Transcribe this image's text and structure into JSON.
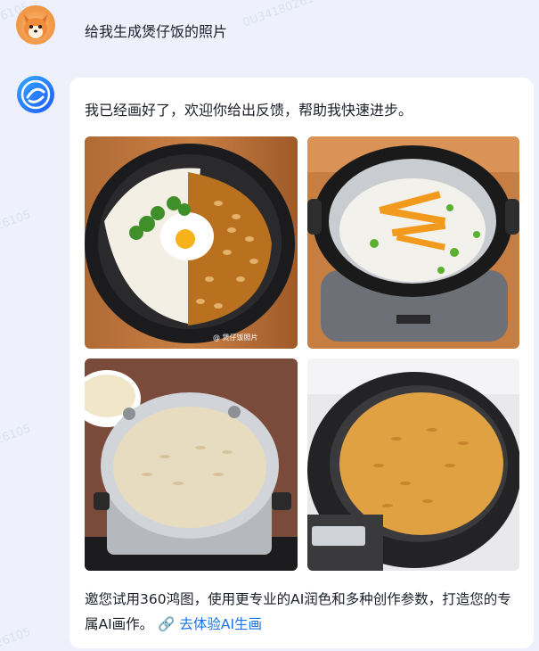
{
  "conversation": {
    "user_prompt": "给我生成煲仔饭的照片",
    "assistant_reply": "我已经画好了，欢迎你给出反馈，帮助我快速进步。",
    "footer_text": "邀您试用360鸿图，使用更专业的AI润色和多种创作参数，打造您的专属AI画作。",
    "footer_link": "去体验AI生画"
  },
  "images": [
    {
      "desc": "rice-with-egg-and-beans"
    },
    {
      "desc": "rice-cooker-with-rice-and-carrots"
    },
    {
      "desc": "pot-of-rice"
    },
    {
      "desc": "rice-cooker-with-golden-rice"
    }
  ],
  "watermarks": [
    "6105",
    "0U3418026105",
    "26105",
    "26105",
    "26105"
  ]
}
